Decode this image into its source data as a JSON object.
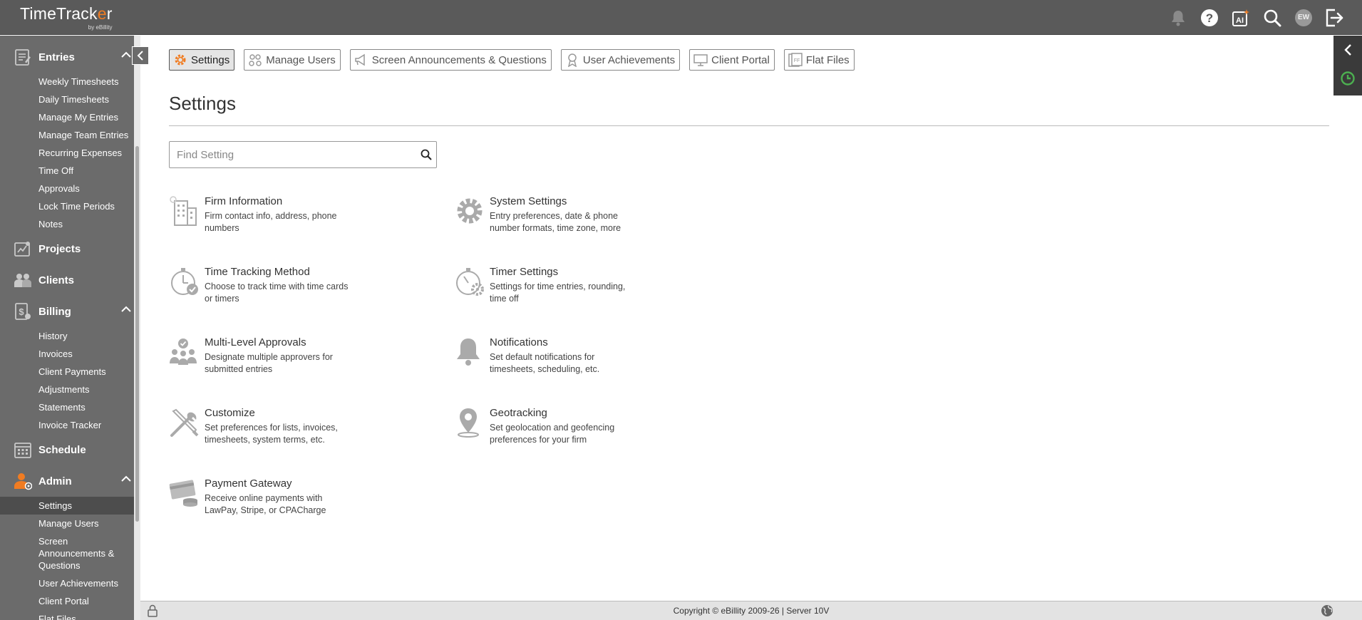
{
  "app": {
    "logo_main_a": "TimeTrack",
    "logo_main_o": "e",
    "logo_main_b": "r",
    "logo_sub": "by eBillity"
  },
  "topbar": {
    "avatar_initials": "EW"
  },
  "sidebar": {
    "sections": [
      {
        "label": "Entries",
        "items": [
          "Weekly Timesheets",
          "Daily Timesheets",
          "Manage My Entries",
          "Manage Team Entries",
          "Recurring Expenses",
          "Time Off",
          "Approvals",
          "Lock Time Periods",
          "Notes"
        ]
      },
      {
        "label": "Projects"
      },
      {
        "label": "Clients"
      },
      {
        "label": "Billing",
        "items": [
          "History",
          "Invoices",
          "Client Payments",
          "Adjustments",
          "Statements",
          "Invoice Tracker"
        ]
      },
      {
        "label": "Schedule"
      },
      {
        "label": "Admin",
        "items": [
          "Settings",
          "Manage Users",
          "Screen Announcements & Questions",
          "User Achievements",
          "Client Portal",
          "Flat Files"
        ]
      }
    ]
  },
  "tabs": [
    "Settings",
    "Manage Users",
    "Screen Announcements & Questions",
    "User Achievements",
    "Client Portal",
    "Flat Files"
  ],
  "page": {
    "title": "Settings",
    "search_placeholder": "Find Setting"
  },
  "settings": [
    {
      "title": "Firm Information",
      "desc": "Firm contact info, address, phone numbers",
      "icon": "building-icon"
    },
    {
      "title": "System Settings",
      "desc": "Entry preferences, date & phone number formats, time zone, more",
      "icon": "gear-icon"
    },
    {
      "title": "Time Tracking Method",
      "desc": "Choose to track time with time cards or timers",
      "icon": "stopwatch-check-icon"
    },
    {
      "title": "Timer Settings",
      "desc": "Settings for time entries, rounding, time off",
      "icon": "stopwatch-gear-icon"
    },
    {
      "title": "Multi-Level Approvals",
      "desc": "Designate multiple approvers for submitted entries",
      "icon": "group-approval-icon"
    },
    {
      "title": "Notifications",
      "desc": "Set default notifications for timesheets, scheduling, etc.",
      "icon": "bell-icon"
    },
    {
      "title": "Customize",
      "desc": "Set preferences for lists, invoices, timesheets, system terms, etc.",
      "icon": "tools-icon"
    },
    {
      "title": "Geotracking",
      "desc": "Set geolocation and geofencing preferences for your firm",
      "icon": "map-pin-icon"
    },
    {
      "title": "Payment Gateway",
      "desc": "Receive online payments with LawPay, Stripe, or CPACharge",
      "icon": "card-coins-icon"
    }
  ],
  "footer": {
    "copyright": "Copyright © eBillity 2009-26  |  Server 10V"
  },
  "colors": {
    "topbar": "#5a5a5a",
    "sidebar": "#6b6b6b",
    "accent_orange": "#f07c22",
    "accent_green": "#4caf50"
  }
}
